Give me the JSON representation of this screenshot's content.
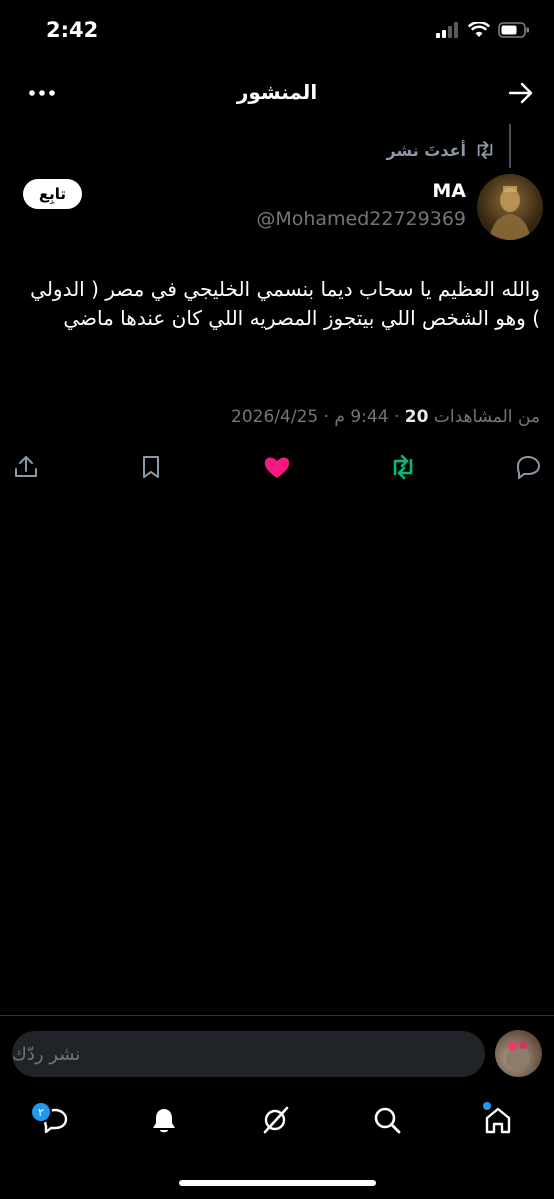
{
  "status_bar": {
    "time": "2:42"
  },
  "header": {
    "title": "المنشور"
  },
  "repost": {
    "label": "أعدتَ نشر"
  },
  "author": {
    "name": "MA",
    "handle": "@Mohamed22729369"
  },
  "follow_button": {
    "label": "تابِع"
  },
  "post": {
    "text": "والله العظيم يا سحاب ديما بنسمي الخليجي في مصر ( الدولي ) وهو الشخص اللي بيتجوز المصريه اللي كان عندها ماضي",
    "date": "2026/4/25",
    "time": "9:44 م",
    "views_count": "20",
    "views_label": "من المشاهدات"
  },
  "reply": {
    "placeholder": "نشر ردّك"
  },
  "nav": {
    "messages_badge": "٢"
  },
  "colors": {
    "like": "#f91880",
    "repost": "#00ba7c",
    "accent": "#1d9bf0"
  },
  "icons": [
    "more-icon",
    "back-arrow-icon",
    "repost-icon",
    "share-icon",
    "bookmark-icon",
    "heart-icon",
    "reply-icon",
    "home-icon",
    "search-icon",
    "grok-icon",
    "bell-icon",
    "messages-icon"
  ]
}
